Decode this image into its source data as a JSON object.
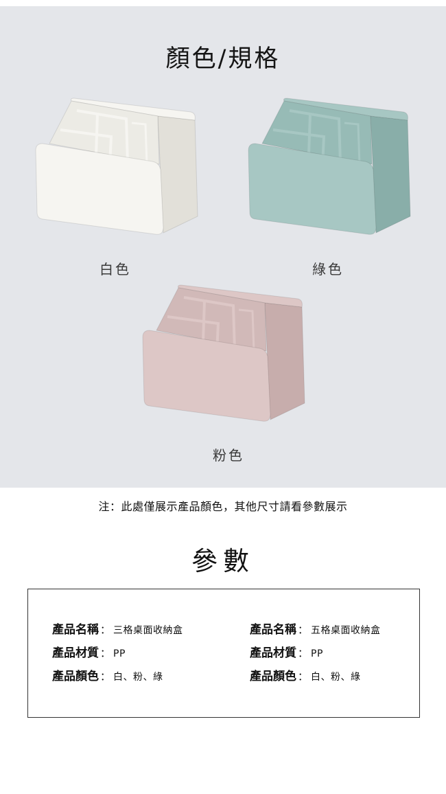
{
  "colors_section": {
    "title": "顏色/規格",
    "products": [
      {
        "label": "白色",
        "fill": "#f6f5f1",
        "inner": "#ecebe5",
        "shade": "#e2e0d9"
      },
      {
        "label": "綠色",
        "fill": "#a7c7c3",
        "inner": "#97bbb6",
        "shade": "#89aea9"
      },
      {
        "label": "粉色",
        "fill": "#ddc7c6",
        "inner": "#d1b9b8",
        "shade": "#c7adac"
      }
    ],
    "background": "#e4e6ea"
  },
  "note": "注：此處僅展示產品顏色，其他尺寸請看參數展示",
  "spec_section": {
    "title": "參數",
    "left": [
      {
        "key": "產品名稱",
        "value": "三格桌面收納盒"
      },
      {
        "key": "產品材質",
        "value": "PP"
      },
      {
        "key": "產品顏色",
        "value": "白、粉、綠"
      }
    ],
    "right": [
      {
        "key": "產品名稱",
        "value": "五格桌面收納盒"
      },
      {
        "key": "產品材質",
        "value": "PP"
      },
      {
        "key": "產品顏色",
        "value": "白、粉、綠"
      }
    ],
    "colon": "："
  }
}
